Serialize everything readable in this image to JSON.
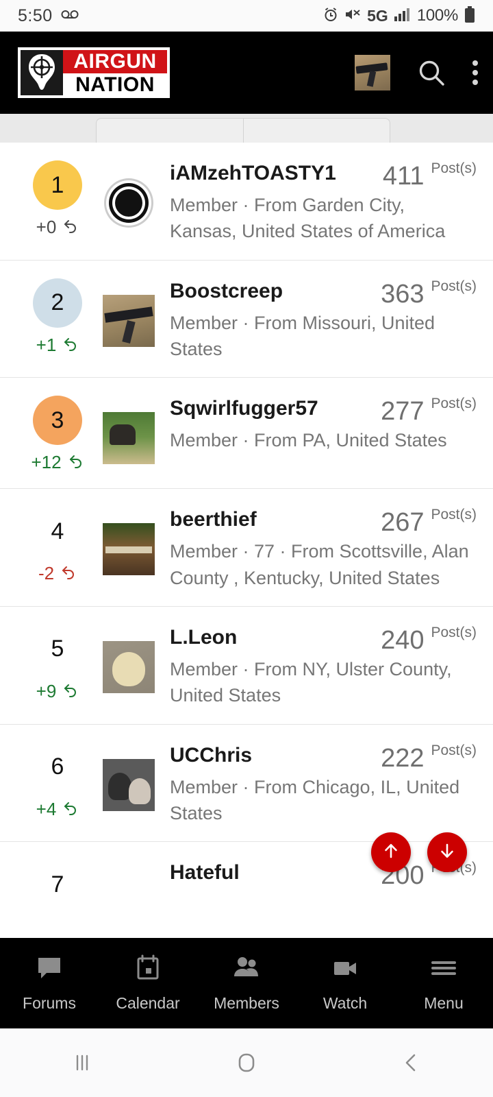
{
  "status_bar": {
    "time": "5:50",
    "voicemail_icon": "voicemail-icon",
    "alarm_icon": "alarm-icon",
    "mute_icon": "volume-mute-icon",
    "network": "5G",
    "signal_icon": "signal-bars-icon",
    "battery_percent": "100%",
    "battery_icon": "battery-full-icon"
  },
  "header": {
    "logo_top": "AIRGUN",
    "logo_bottom": "NATION",
    "logo_mark": "crosshair-target-icon",
    "avatar_icon": "user-avatar",
    "search_icon": "search-icon",
    "overflow_icon": "more-vertical-icon"
  },
  "colors": {
    "rank1": "#f9c84c",
    "rank2": "#cfdee8",
    "rank3": "#f4a45e",
    "up": "#1d7a32",
    "down": "#c0392b",
    "fab": "#cc0000",
    "brand_red": "#d01317"
  },
  "list": {
    "post_label": "Post(s)",
    "rows": [
      {
        "rank": "1",
        "delta": "+0",
        "delta_dir": "flat",
        "badge": "gold",
        "avatar": "target",
        "username": "iAMzehTOASTY1",
        "count": "411",
        "meta": "Member · From Garden City, Kansas, United States of America"
      },
      {
        "rank": "2",
        "delta": "+1",
        "delta_dir": "up",
        "badge": "silver",
        "avatar": "rifle",
        "username": "Boostcreep",
        "count": "363",
        "meta": "Member · From Missouri, United States"
      },
      {
        "rank": "3",
        "delta": "+12",
        "delta_dir": "up",
        "badge": "bronze",
        "avatar": "field",
        "username": "Sqwirlfugger57",
        "count": "277",
        "meta": "Member · From PA, United States"
      },
      {
        "rank": "4",
        "delta": "-2",
        "delta_dir": "down",
        "badge": "none",
        "avatar": "wood",
        "username": "beerthief",
        "count": "267",
        "meta": "Member · 77 · From Scottsville, Alan County , Kentucky, United States"
      },
      {
        "rank": "5",
        "delta": "+9",
        "delta_dir": "up",
        "badge": "none",
        "avatar": "dog",
        "username": "L.Leon",
        "count": "240",
        "meta": "Member · From NY, Ulster County, United States"
      },
      {
        "rank": "6",
        "delta": "+4",
        "delta_dir": "up",
        "badge": "none",
        "avatar": "couple",
        "username": "UCChris",
        "count": "222",
        "meta": "Member · From Chicago, IL, United States"
      },
      {
        "rank": "7",
        "delta": "",
        "delta_dir": "flat",
        "badge": "none",
        "avatar": "none",
        "username": "Hateful",
        "count": "200",
        "meta": ""
      }
    ]
  },
  "fabs": {
    "up_icon": "arrow-up-icon",
    "down_icon": "arrow-down-icon"
  },
  "bottom_nav": {
    "items": [
      {
        "label": "Forums",
        "icon": "chat-bubble-icon"
      },
      {
        "label": "Calendar",
        "icon": "calendar-icon"
      },
      {
        "label": "Members",
        "icon": "people-icon"
      },
      {
        "label": "Watch",
        "icon": "video-camera-icon"
      },
      {
        "label": "Menu",
        "icon": "hamburger-menu-icon"
      }
    ]
  },
  "android_nav": {
    "recents_icon": "recents-icon",
    "home_icon": "home-icon",
    "back_icon": "back-icon"
  }
}
